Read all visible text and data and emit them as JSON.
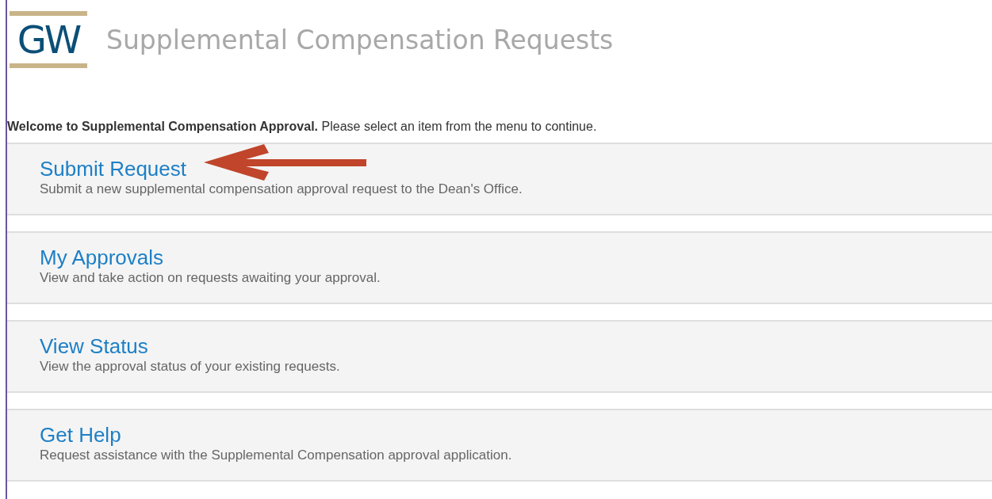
{
  "header": {
    "logo": "GW",
    "title": "Supplemental Compensation Requests"
  },
  "welcome": "**Welcome to Supplemental Compensation Approval.** Please select an item from the menu to continue.",
  "menu": [
    {
      "title": "Submit Request",
      "description": "Submit a new supplemental compensation approval request to the Dean's Office.",
      "highlighted": true
    },
    {
      "title": "My Approvals",
      "description": "View and take action on requests awaiting your approval.",
      "highlighted": false
    },
    {
      "title": "View Status",
      "description": "View the approval status of your existing requests.",
      "highlighted": false
    },
    {
      "title": "Get Help",
      "description": "Request assistance with the Supplemental Compensation approval application.",
      "highlighted": false
    }
  ]
}
